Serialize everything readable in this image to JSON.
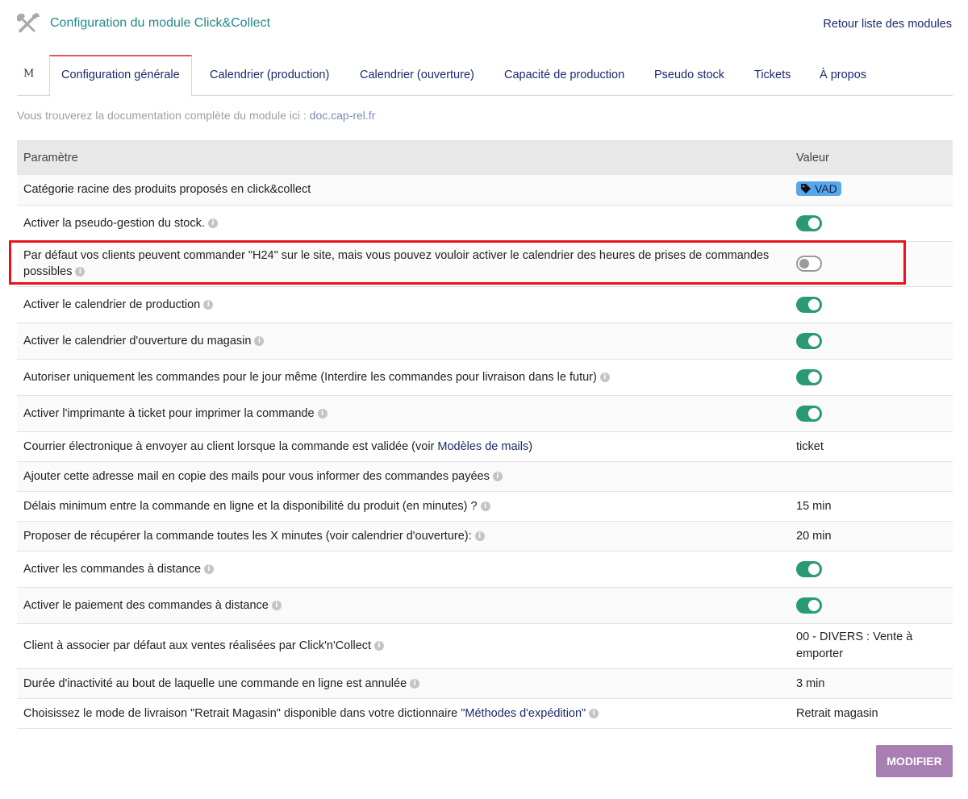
{
  "header": {
    "title": "Configuration du module Click&Collect",
    "back_link": "Retour liste des modules"
  },
  "tabs": {
    "first": "M",
    "items": [
      "Configuration générale",
      "Calendrier (production)",
      "Calendrier (ouverture)",
      "Capacité de production",
      "Pseudo stock",
      "Tickets",
      "À propos"
    ]
  },
  "doc": {
    "text": "Vous trouverez la documentation complète du module ici : ",
    "link": "doc.cap-rel.fr"
  },
  "table": {
    "col_param": "Paramètre",
    "col_value": "Valeur",
    "rows": [
      {
        "label": "Catégorie racine des produits proposés en click&collect",
        "value": "VAD"
      },
      {
        "label": "Activer la pseudo-gestion du stock.",
        "value": "on"
      },
      {
        "label": "Par défaut vos clients peuvent commander \"H24\" sur le site, mais vous pouvez vouloir activer le calendrier des heures de prises de commandes possibles",
        "value": "off"
      },
      {
        "label": "Activer le calendrier de production",
        "value": "on"
      },
      {
        "label": "Activer le calendrier d'ouverture du magasin",
        "value": "on"
      },
      {
        "label": "Autoriser uniquement les commandes pour le jour même (Interdire les commandes pour livraison dans le futur)",
        "value": "on"
      },
      {
        "label": "Activer l'imprimante à ticket pour imprimer la commande",
        "value": "on"
      },
      {
        "label": "Courrier électronique à envoyer au client lorsque la commande est validée (voir ",
        "link": "Modèles de mails",
        "suffix": ")",
        "value": "ticket"
      },
      {
        "label": "Ajouter cette adresse mail en copie des mails pour vous informer des commandes payées",
        "value": ""
      },
      {
        "label": "Délais minimum entre la commande en ligne et la disponibilité du produit (en minutes) ?",
        "value": "15 min"
      },
      {
        "label": "Proposer de récupérer la commande toutes les X minutes (voir calendrier d'ouverture):",
        "value": "20 min"
      },
      {
        "label": "Activer les commandes à distance",
        "value": "on"
      },
      {
        "label": "Activer le paiement des commandes à distance",
        "value": "on"
      },
      {
        "label": "Client à associer par défaut aux ventes réalisées par Click'n'Collect",
        "value": "00 - DIVERS : Vente à emporter"
      },
      {
        "label": "Durée d'inactivité au bout de laquelle une commande en ligne est annulée",
        "value": "3 min"
      },
      {
        "label": "Choisissez le mode de livraison \"Retrait Magasin\" disponible dans votre dictionnaire ",
        "link": "\"Méthodes d'expédition\"",
        "value": "Retrait magasin"
      }
    ]
  },
  "actions": {
    "modify": "MODIFIER"
  },
  "colors": {
    "toggle_on": "#2a9a74",
    "tab_accent": "#e0585b",
    "button": "#a77fb3",
    "highlight": "#e8141b"
  }
}
